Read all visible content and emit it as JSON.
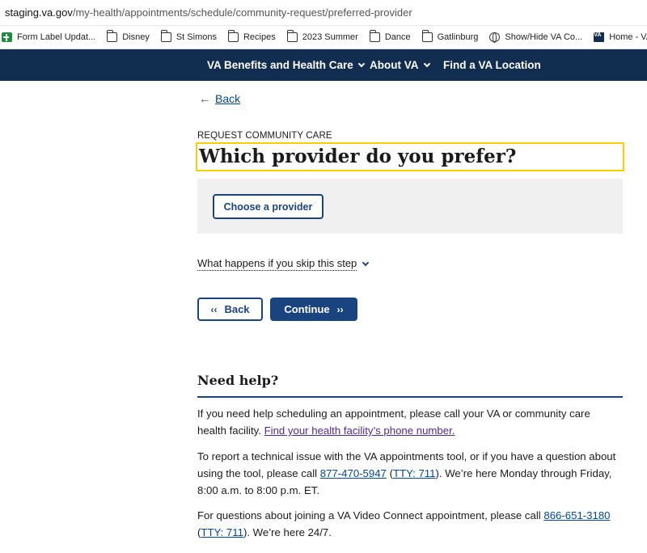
{
  "browser": {
    "url_host": "staging.va.gov",
    "url_path": "/my-health/appointments/schedule/community-request/preferred-provider"
  },
  "bookmarks": [
    {
      "label": "Form Label Updat...",
      "icon": "sheets-icon"
    },
    {
      "label": "Disney",
      "icon": "folder-icon"
    },
    {
      "label": "St Simons",
      "icon": "folder-icon"
    },
    {
      "label": "Recipes",
      "icon": "folder-icon"
    },
    {
      "label": "2023 Summer",
      "icon": "folder-icon"
    },
    {
      "label": "Dance",
      "icon": "folder-icon"
    },
    {
      "label": "Gatlinburg",
      "icon": "folder-icon"
    },
    {
      "label": "Show/Hide VA Co...",
      "icon": "globe-icon"
    },
    {
      "label": "Home - VA Web G...",
      "icon": "va-logo-icon",
      "icon_text": "VA"
    }
  ],
  "nav": {
    "benefits": "VA Benefits and Health Care",
    "about": "About VA",
    "find": "Find a VA Location"
  },
  "page": {
    "back_link": "Back",
    "eyebrow": "REQUEST COMMUNITY CARE",
    "title": "Which provider do you prefer?",
    "choose_provider": "Choose a provider",
    "skip_info": "What happens if you skip this step",
    "back_button": "Back",
    "continue_button": "Continue"
  },
  "help": {
    "title": "Need help?",
    "p1_text": "If you need help scheduling an appointment, please call your VA or community care health facility. ",
    "p1_link": "Find your health facility’s phone number.",
    "p2_text_a": "To report a technical issue with the VA appointments tool, or if you have a question about using the tool, please call ",
    "p2_phone": "877-470-5947",
    "p2_text_b": " (",
    "p2_tty": "TTY: 711",
    "p2_text_c": "). We’re here Monday through Friday, 8:00 a.m. to 8:00 p.m. ET.",
    "p3_text_a": "For questions about joining a VA Video Connect appointment, please call ",
    "p3_phone": "866-651-3180",
    "p3_text_b": " (",
    "p3_tty": "TTY: 711",
    "p3_text_c": "). We’re here 24/7."
  },
  "colors": {
    "nav_bg": "#112e51",
    "primary": "#1a4480",
    "link": "#004795",
    "visited_link": "#54278f",
    "focus": "#face00",
    "panel_bg": "#f0f0f0"
  }
}
